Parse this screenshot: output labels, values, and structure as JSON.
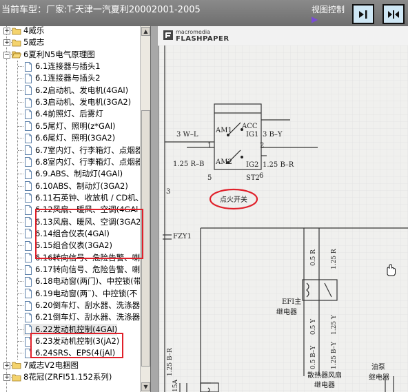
{
  "header": {
    "title": "当前车型：厂家:T-天津一汽夏利20002001-2005",
    "view_control_label": "视图控制",
    "arrow_glyph": "▶"
  },
  "tree": {
    "items": [
      {
        "label": "4威乐",
        "level": 0,
        "type": "folder",
        "toggle": "+"
      },
      {
        "label": "5威志",
        "level": 0,
        "type": "folder",
        "toggle": "+"
      },
      {
        "label": "6夏利N5电气原理图",
        "level": 0,
        "type": "folder-open",
        "toggle": "−"
      },
      {
        "label": "6.1连接器与插头1",
        "level": 1,
        "type": "doc"
      },
      {
        "label": "6.1连接器与插头2",
        "level": 1,
        "type": "doc"
      },
      {
        "label": "6.2启动机、发电机(4GAl)",
        "level": 1,
        "type": "doc"
      },
      {
        "label": "6.3启动机、发电机(3GA2)",
        "level": 1,
        "type": "doc"
      },
      {
        "label": "6.4前照灯、后雾灯",
        "level": 1,
        "type": "doc"
      },
      {
        "label": "6.5尾灯、照明(z*GAl)",
        "level": 1,
        "type": "doc"
      },
      {
        "label": "6.6尾灯、照明(3GA2)",
        "level": 1,
        "type": "doc"
      },
      {
        "label": "6.7室内灯、行李箱灯、点烟器",
        "level": 1,
        "type": "doc"
      },
      {
        "label": "6.8室内灯、行李箱灯、点烟器",
        "level": 1,
        "type": "doc"
      },
      {
        "label": "6.9.ABS、制动灯(4GAl)",
        "level": 1,
        "type": "doc"
      },
      {
        "label": "6.10ABS、制动灯(3GA2)",
        "level": 1,
        "type": "doc"
      },
      {
        "label": "6.11石英钟、收放机 / CD机、",
        "level": 1,
        "type": "doc"
      },
      {
        "label": "6.12风扇、暖风、空调(4GAl",
        "level": 1,
        "type": "doc"
      },
      {
        "label": "6.13风扇、暖风、空调(3GA2",
        "level": 1,
        "type": "doc"
      },
      {
        "label": "6.14组合仪表(4GAl)",
        "level": 1,
        "type": "doc"
      },
      {
        "label": "6.15组合仪表(3GA2)",
        "level": 1,
        "type": "doc"
      },
      {
        "label": "6.16转向信号、危险告警、喇",
        "level": 1,
        "type": "doc"
      },
      {
        "label": "6.17转向信号、危险告警、喇",
        "level": 1,
        "type": "doc"
      },
      {
        "label": "6.18电动窗(两门)、中控锁(带",
        "level": 1,
        "type": "doc"
      },
      {
        "label": "6.19电动窗(两¨)、中控锁(不",
        "level": 1,
        "type": "doc"
      },
      {
        "label": "6.20倒车灯、刮水器、洗涤器",
        "level": 1,
        "type": "doc"
      },
      {
        "label": "6.21倒车灯、刮水器、洗涤器",
        "level": 1,
        "type": "doc"
      },
      {
        "label": "6.22发动机控制(4GAl)",
        "level": 1,
        "type": "doc",
        "selected": true
      },
      {
        "label": "6.23发动机控制(3(jA2)",
        "level": 1,
        "type": "doc"
      },
      {
        "label": "6.24SRS、EPS(4(jAl)",
        "level": 1,
        "type": "doc"
      },
      {
        "label": "7威志V2电捆图",
        "level": 0,
        "type": "folder",
        "toggle": "+"
      },
      {
        "label": "8花冠(ZRFI51.152系列)",
        "level": 0,
        "type": "folder",
        "toggle": "+"
      }
    ]
  },
  "viewer": {
    "brand_top": "macromedia",
    "brand_bottom": "FLASHPAPER"
  },
  "schematic": {
    "labels": {
      "w1": "3 W–L",
      "n1": "1",
      "am1": "AM1",
      "acc": "ACC",
      "ig1": "IG1",
      "out1": "3 B–Y",
      "n2": "2",
      "w2": "1.25 R–B",
      "am2": "AM2",
      "ig2": "IG2",
      "out2": "1.25 B–R",
      "n5": "5",
      "st2": "ST2",
      "n6": "6",
      "ignition": "点火开关",
      "n3": "3",
      "fuse": "FZY1",
      "r05": "0.5 R",
      "r125": "1.25 R",
      "efi1": "EFI主",
      "efi2": "继电器",
      "y05": "0.5 Y",
      "y125": "1.25 Y",
      "by05": "0.5 B–Y",
      "by125": "1.25 B–Y",
      "br125": "1.25 B–R",
      "fan1": "散热器风扇",
      "fan2": "继电器",
      "pump1": "油泵",
      "pump2": "继电器",
      "f15a": "15A"
    }
  }
}
